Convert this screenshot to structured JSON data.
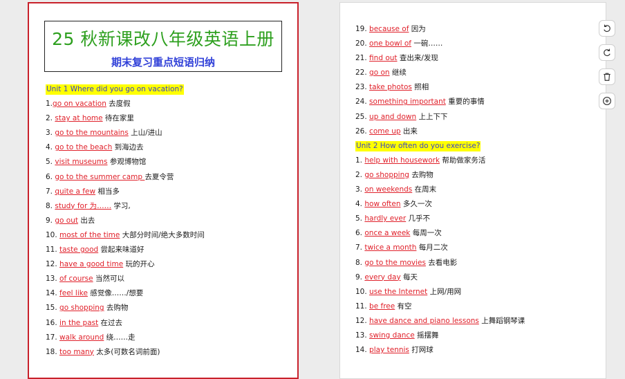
{
  "page1": {
    "title": "25 秋新课改八年级英语上册",
    "subtitle": "期末复习重点短语归纳",
    "rows": [
      {
        "unit": "Unit 1 Where did you go on vacation?"
      },
      {
        "num": "1.",
        "en": "go on vacation",
        "zh": " 去度假"
      },
      {
        "num": "2. ",
        "en": "stay at home",
        "zh": " 待在家里"
      },
      {
        "num": "3. ",
        "en": "go to the mountains",
        "zh": " 上山/进山"
      },
      {
        "num": "4. ",
        "en": "go to the beach",
        "zh": " 到海边去"
      },
      {
        "num": "5. ",
        "en": "visit museums",
        "zh": " 参观博物馆"
      },
      {
        "num": "6. ",
        "en": "go to the summer camp ",
        "zh": "去夏令营"
      },
      {
        "num": "7. ",
        "en": "quite a few",
        "zh": " 相当多"
      },
      {
        "num": "8. ",
        "en": "study for 为……",
        "zh": " 学习,"
      },
      {
        "num": "9. ",
        "en": "go out",
        "zh": " 出去"
      },
      {
        "num": "10. ",
        "en": "most of the time",
        "zh": " 大部分时间/绝大多数时间"
      },
      {
        "num": "11. ",
        "en": "taste good",
        "zh": " 尝起来味道好"
      },
      {
        "num": "12. ",
        "en": "have a good time",
        "zh": " 玩的开心"
      },
      {
        "num": "13. ",
        "en": "of course",
        "zh": " 当然可以"
      },
      {
        "num": "14. ",
        "en": "feel like",
        "zh": " 感觉像……/想要"
      },
      {
        "num": "15. ",
        "en": "go shopping",
        "zh": " 去购物"
      },
      {
        "num": "16. ",
        "en": "in the past",
        "zh": " 在过去"
      },
      {
        "num": "17. ",
        "en": "walk around",
        "zh": " 绕……走"
      },
      {
        "num": "18. ",
        "en": "too many",
        "zh": " 太多(可数名词前面)"
      }
    ]
  },
  "page2": {
    "rows": [
      {
        "num": "19. ",
        "en": "because of",
        "zh": " 因为"
      },
      {
        "num": "20. ",
        "en": "one bowl of",
        "zh": " 一碗……"
      },
      {
        "num": "21. ",
        "en": "find out",
        "zh": " 查出来/发现"
      },
      {
        "num": "22. ",
        "en": "go on",
        "zh": " 继续"
      },
      {
        "num": "23. ",
        "en": "take photos",
        "zh": " 照相"
      },
      {
        "num": "24. ",
        "en": "something important",
        "zh": " 重要的事情"
      },
      {
        "num": "25. ",
        "en": "up and down",
        "zh": " 上上下下"
      },
      {
        "num": "26. ",
        "en": "come up",
        "zh": " 出来"
      },
      {
        "unit": "Unit 2 How often do you exercise?"
      },
      {
        "num": "1. ",
        "en": "help with housework",
        "zh": " 帮助做家务活"
      },
      {
        "num": "2. ",
        "en": "go shopping",
        "zh": " 去购物"
      },
      {
        "num": "3. ",
        "en": "on weekends",
        "zh": " 在周末"
      },
      {
        "num": "4. ",
        "en": "how often",
        "zh": " 多久一次"
      },
      {
        "num": "5. ",
        "en": "hardly ever",
        "zh": " 几乎不"
      },
      {
        "num": "6. ",
        "en": "once a week",
        "zh": " 每周一次"
      },
      {
        "num": "7. ",
        "en": "twice a month",
        "zh": " 每月二次"
      },
      {
        "num": "8. ",
        "en": "go to the movies",
        "zh": " 去看电影"
      },
      {
        "num": "9. ",
        "en": "every day",
        "zh": " 每天"
      },
      {
        "num": "10. ",
        "en": "use the Internet",
        "zh": " 上网/用网"
      },
      {
        "num": "11. ",
        "en": "be free",
        "zh": " 有空"
      },
      {
        "num": "12. ",
        "en": "have dance and piano lessons",
        "zh": " 上舞蹈钢琴课"
      },
      {
        "num": "13. ",
        "en": "swing dance",
        "zh": " 摇摆舞"
      },
      {
        "num": "14. ",
        "en": "play tennis",
        "zh": " 打网球"
      }
    ]
  },
  "toolbar": {
    "buttons": [
      {
        "name": "rotate-left-button",
        "icon": "rotate-left-icon"
      },
      {
        "name": "rotate-right-button",
        "icon": "rotate-right-icon"
      },
      {
        "name": "delete-button",
        "icon": "trash-icon"
      },
      {
        "name": "add-button",
        "icon": "plus-circle-icon"
      }
    ]
  }
}
